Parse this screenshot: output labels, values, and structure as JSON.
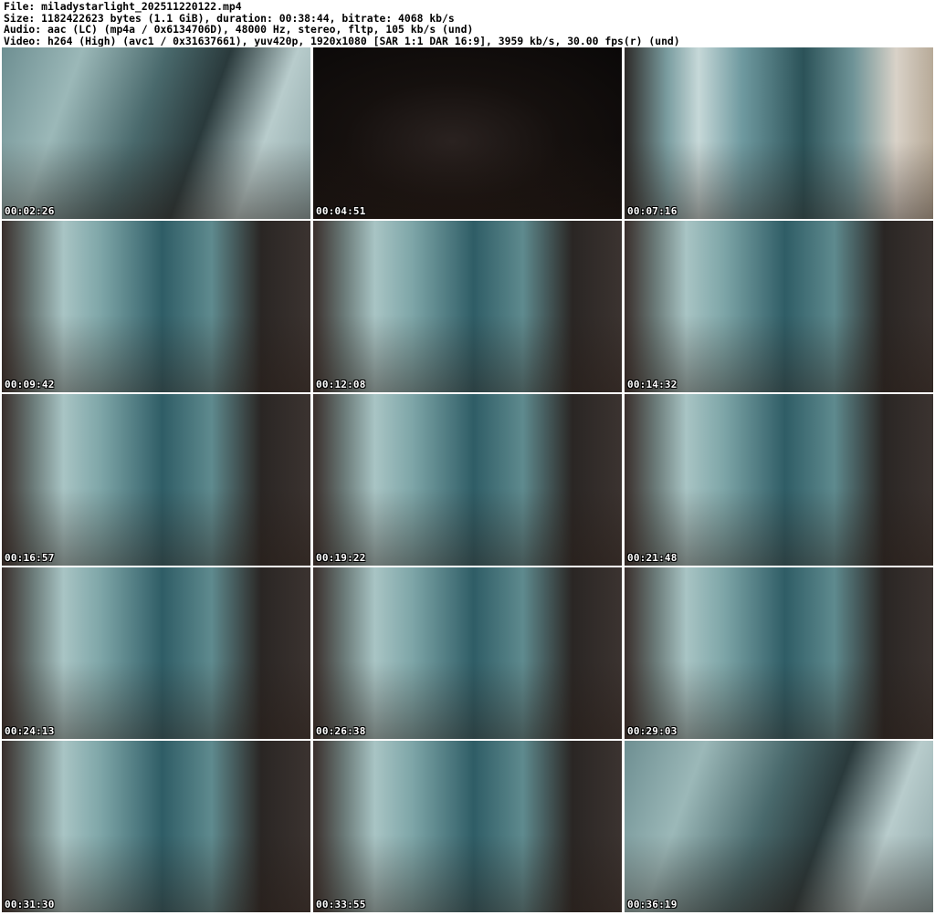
{
  "header": {
    "file_line": "File: miladystarlight_202511220122.mp4",
    "size_line": "Size: 1182422623 bytes (1.1 GiB), duration: 00:38:44, bitrate: 4068 kb/s",
    "audio_line": "Audio: aac (LC) (mp4a / 0x6134706D), 48000 Hz, stereo, fltp, 105 kb/s (und)",
    "video_line": "Video: h264 (High) (avc1 / 0x31637661), yuv420p, 1920x1080 [SAR 1:1 DAR 16:9], 3959 kb/s, 30.00 fps(r) (und)"
  },
  "thumbnails": [
    {
      "timestamp": "00:02:26"
    },
    {
      "timestamp": "00:04:51"
    },
    {
      "timestamp": "00:07:16"
    },
    {
      "timestamp": "00:09:42"
    },
    {
      "timestamp": "00:12:08"
    },
    {
      "timestamp": "00:14:32"
    },
    {
      "timestamp": "00:16:57"
    },
    {
      "timestamp": "00:19:22"
    },
    {
      "timestamp": "00:21:48"
    },
    {
      "timestamp": "00:24:13"
    },
    {
      "timestamp": "00:26:38"
    },
    {
      "timestamp": "00:29:03"
    },
    {
      "timestamp": "00:31:30"
    },
    {
      "timestamp": "00:33:55"
    },
    {
      "timestamp": "00:36:19"
    }
  ]
}
